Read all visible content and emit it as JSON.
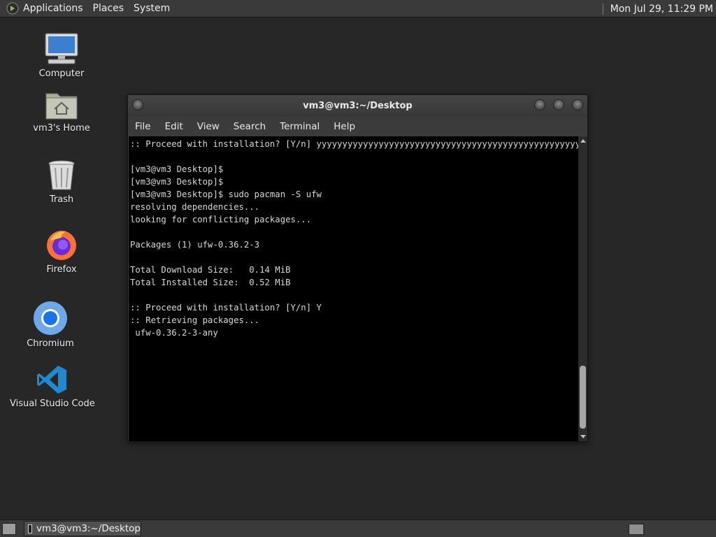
{
  "top_panel": {
    "menus": [
      "Applications",
      "Places",
      "System"
    ],
    "clock": "Mon Jul 29, 11:29 PM"
  },
  "desktop_icons": [
    {
      "label": "Computer",
      "icon": "computer-icon"
    },
    {
      "label": "vm3's Home",
      "icon": "home-folder-icon"
    },
    {
      "label": "Trash",
      "icon": "trash-icon"
    },
    {
      "label": "Firefox",
      "icon": "firefox-icon"
    },
    {
      "label": "Chromium",
      "icon": "chromium-icon"
    },
    {
      "label": "Visual Studio Code",
      "icon": "vscode-icon"
    }
  ],
  "terminal": {
    "title": "vm3@vm3:~/Desktop",
    "menu": [
      "File",
      "Edit",
      "View",
      "Search",
      "Terminal",
      "Help"
    ],
    "lines": [
      ":: Proceed with installation? [Y/n] yyyyyyyyyyyyyyyyyyyyyyyyyyyyyyyyyyyyyyyyyyyyyyyyyyyyyyyy",
      "",
      "[vm3@vm3 Desktop]$",
      "[vm3@vm3 Desktop]$",
      "[vm3@vm3 Desktop]$ sudo pacman -S ufw",
      "resolving dependencies...",
      "looking for conflicting packages...",
      "",
      "Packages (1) ufw-0.36.2-3",
      "",
      "Total Download Size:   0.14 MiB",
      "Total Installed Size:  0.52 MiB",
      "",
      ":: Proceed with installation? [Y/n] Y",
      ":: Retrieving packages...",
      " ufw-0.36.2-3-any"
    ]
  },
  "taskbar": {
    "window_button": "vm3@vm3:~/Desktop"
  }
}
